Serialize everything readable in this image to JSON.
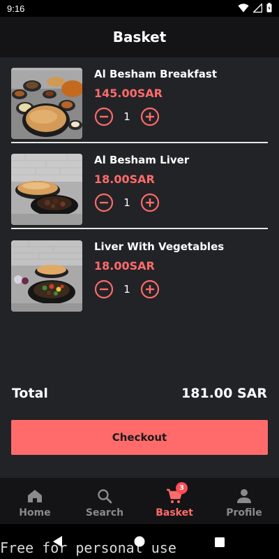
{
  "status_bar": {
    "time": "9:16"
  },
  "header": {
    "title": "Basket"
  },
  "items": [
    {
      "name": "Al Besham Breakfast",
      "price": "145.00SAR",
      "quantity": "1"
    },
    {
      "name": "Al Besham Liver",
      "price": "18.00SAR",
      "quantity": "1"
    },
    {
      "name": "Liver With Vegetables",
      "price": "18.00SAR",
      "quantity": "1"
    }
  ],
  "summary": {
    "total_label": "Total",
    "total_value": "181.00 SAR"
  },
  "checkout": {
    "label": "Checkout"
  },
  "bottom_nav": {
    "items": [
      {
        "label": "Home",
        "icon": "home-icon",
        "active": false
      },
      {
        "label": "Search",
        "icon": "search-icon",
        "active": false
      },
      {
        "label": "Basket",
        "icon": "cart-icon",
        "active": true,
        "badge": "3"
      },
      {
        "label": "Profile",
        "icon": "person-icon",
        "active": false
      }
    ]
  },
  "watermark": "Free for personal use",
  "colors": {
    "accent": "#ff6b6b",
    "background": "#222326",
    "header": "#141416",
    "badge": "#ff4d57"
  }
}
